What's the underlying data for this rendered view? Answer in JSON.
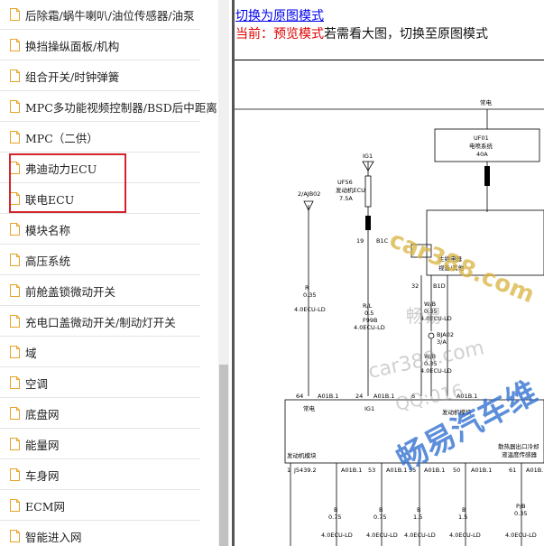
{
  "sidebar": {
    "items": [
      {
        "label": "后除霜/蜗牛喇叭/油位传感器/油泵"
      },
      {
        "label": "换挡操纵面板/机构"
      },
      {
        "label": "组合开关/时钟弹簧"
      },
      {
        "label": "MPC多功能视频控制器/BSD后中距离"
      },
      {
        "label": "MPC（二供）"
      },
      {
        "label": "弗迪动力ECU"
      },
      {
        "label": "联电ECU"
      },
      {
        "label": "模块名称"
      },
      {
        "label": "高压系统"
      },
      {
        "label": "前舱盖锁微动开关"
      },
      {
        "label": "充电口盖微动开关/制动灯开关"
      },
      {
        "label": "域"
      },
      {
        "label": "空调"
      },
      {
        "label": "底盘网"
      },
      {
        "label": "能量网"
      },
      {
        "label": "车身网"
      },
      {
        "label": "ECM网"
      },
      {
        "label": "智能进入网"
      }
    ]
  },
  "content": {
    "switch_link": "切换为原图模式",
    "current_label": "当前：",
    "preview_mode": "预览模式",
    "hint": "若需看大图，切换至原图模式"
  },
  "schematic": {
    "labels": {
      "top_power": "常电",
      "fuse_uf01_id": "UF01",
      "fuse_uf01_name": "电喷系统",
      "fuse_uf01_rating": "40A",
      "ig1_top": "IG1",
      "fuse_uf56_id": "UF56",
      "fuse_uf56_name": "发动机ECU",
      "fuse_uf56_rating": "7.5A",
      "pin_19": "19",
      "conn_b1c": "B1C",
      "ground_ref": "2/AJB02",
      "relay_name": "主继电器",
      "relay_sub": "视备/其他",
      "pin_32": "32",
      "conn_b1d": "B1D",
      "wire_r_color": "R",
      "wire_r_size": "0.35",
      "wire_r_conn": "4.0ECU-LD",
      "wire_rl_color": "R/L",
      "wire_rl_size": "0.5",
      "wire_rl_id": "F99B",
      "wire_rl_conn": "4.0ECU-LD",
      "wire_wb_color": "W/B",
      "wire_wb_size": "0.35",
      "wire_wb_conn": "4.0ECU-LD",
      "splice_id": "BJA02",
      "splice_sub": "3/A",
      "wire_wb2_color": "W/B",
      "wire_wb2_size": "0.35",
      "wire_wb2_conn": "4.0ECU-LD",
      "pin_64": "64",
      "conn_a01b1_a": "A01B.1",
      "pin_24": "24",
      "conn_a01b1_b": "A01B.1",
      "pin_6": "6",
      "conn_a01b1_c": "A01B.1",
      "ecu_power": "常电",
      "ecu_ig1": "IG1",
      "ecu_name": "发动机模块",
      "ecu_right_1": "散热器出口冷却",
      "ecu_right_2": "液温度传感器",
      "bot_pin_1": "1",
      "bot_conn_1": "J5439.2",
      "bot_conn_2": "A01B.1",
      "bot_pin_53": "53",
      "bot_conn_3": "A01B.1",
      "bot_pin_55": "55",
      "bot_conn_4": "A01B.1",
      "bot_pin_50": "50",
      "bot_conn_5": "A01B.1",
      "bot_pin_61": "61",
      "bot_conn_6": "A01B.1",
      "bot_w1_color": "B",
      "bot_w1_size": "0.75",
      "bot_w1_conn": "4.0ECU-LD",
      "bot_w2_color": "B",
      "bot_w2_size": "0.75",
      "bot_w2_conn": "4.0ECU-LD",
      "bot_w3_color": "B",
      "bot_w3_size": "1.5",
      "bot_w3_conn": "4.0ECU-LD",
      "bot_w4_color": "B",
      "bot_w4_size": "1.5",
      "bot_w4_conn": "4.0ECU-LD",
      "bot_w5_color": "P/B",
      "bot_w5_size": "0.35",
      "bot_w5_conn": "4.0ECU-LD"
    },
    "watermarks": {
      "logo_text": "car388.com",
      "brand_1": "畅易",
      "site_2": "car388.com",
      "qq": "QQ:016",
      "brand_big": "畅易汽车维"
    }
  }
}
